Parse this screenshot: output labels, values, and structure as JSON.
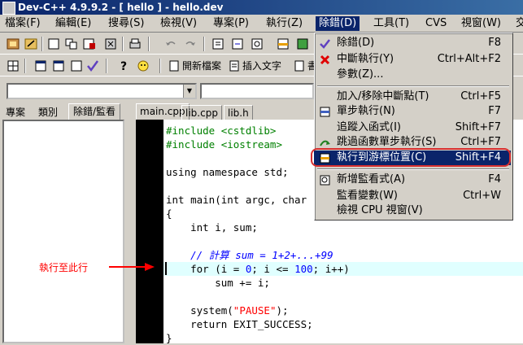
{
  "window": {
    "title": "Dev-C++ 4.9.9.2  -  [ hello ] - hello.dev"
  },
  "menubar": {
    "items": [
      {
        "label": "檔案(F)"
      },
      {
        "label": "編輯(E)"
      },
      {
        "label": "搜尋(S)"
      },
      {
        "label": "檢視(V)"
      },
      {
        "label": "專案(P)"
      },
      {
        "label": "執行(Z)"
      },
      {
        "label": "除錯(D)"
      },
      {
        "label": "工具(T)"
      },
      {
        "label": "CVS"
      },
      {
        "label": "視窗(W)"
      },
      {
        "label": "交"
      }
    ]
  },
  "toolbar": {
    "new_file_label": "開新檔案",
    "insert_text_label": "插入文字",
    "truncated_label": "書"
  },
  "left_panel": {
    "tabs": [
      {
        "label": "專案"
      },
      {
        "label": "類別"
      },
      {
        "label": "除錯/監看"
      }
    ]
  },
  "file_tabs": [
    {
      "label": "main.cpp"
    },
    {
      "label": "lib.cpp"
    },
    {
      "label": "lib.h"
    }
  ],
  "code": {
    "lines": [
      {
        "pp": "#include <cstdlib>"
      },
      {
        "pp": "#include <iostream>"
      },
      {
        "text": ""
      },
      {
        "text": "using namespace std;"
      },
      {
        "text": ""
      },
      {
        "text": "int main(int argc, char"
      },
      {
        "text": "{"
      },
      {
        "text": "    int i, sum;"
      },
      {
        "text": ""
      },
      {
        "comment": "    // 計算 sum = 1+2+...+99"
      },
      {
        "before": "    for (i = ",
        "n1": "0",
        "mid": "; i <= ",
        "n2": "100",
        "after": "; i++)"
      },
      {
        "text": "        sum += i;"
      },
      {
        "text": ""
      },
      {
        "before": "    system(",
        "str": "\"PAUSE\"",
        "after": ");"
      },
      {
        "text": "    return EXIT_SUCCESS;"
      },
      {
        "text": "}"
      }
    ]
  },
  "annotation": {
    "label": "執行至此行"
  },
  "debug_menu": {
    "items": [
      {
        "label": "除錯(D)",
        "shortcut": "F8",
        "icon": "check-icon"
      },
      {
        "label": "中斷執行(Y)",
        "shortcut": "Ctrl+Alt+F2",
        "icon": "stop-x-icon"
      },
      {
        "label": "參數(Z)...",
        "shortcut": ""
      },
      {
        "label": "加入/移除中斷點(T)",
        "shortcut": "Ctrl+F5"
      },
      {
        "label": "單步執行(N)",
        "shortcut": "F7",
        "icon": "step-icon"
      },
      {
        "label": "追蹤入函式(I)",
        "shortcut": "Shift+F7"
      },
      {
        "label": "跳過函數單步執行(S)",
        "shortcut": "Ctrl+F7",
        "icon": "step-over-icon"
      },
      {
        "label": "執行到游標位置(C)",
        "shortcut": "Shift+F4",
        "icon": "run-to-cursor-icon"
      },
      {
        "label": "新增監看式(A)",
        "shortcut": "F4",
        "icon": "add-watch-icon"
      },
      {
        "label": "監看變數(W)",
        "shortcut": "Ctrl+W"
      },
      {
        "label": "檢視 CPU 視窗(V)",
        "shortcut": ""
      }
    ]
  },
  "colors": {
    "highlight": "#0a246a",
    "annotation": "#ff0000",
    "exec_line": "#e0ffff",
    "menu_outline": "#d83030"
  }
}
